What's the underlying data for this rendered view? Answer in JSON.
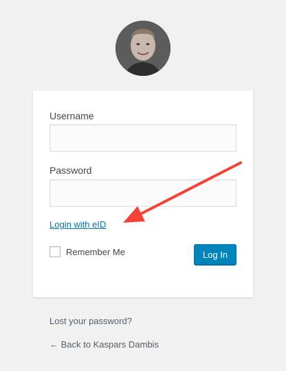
{
  "form": {
    "username_label": "Username",
    "username_value": "",
    "password_label": "Password",
    "password_value": "",
    "eid_link": "Login with eID",
    "remember_label": "Remember Me",
    "remember_checked": false,
    "login_button": "Log In"
  },
  "footer": {
    "lost_password": "Lost your password?",
    "back_link": "← Back to Kaspars Dambis"
  },
  "colors": {
    "page_background": "#f1f1f1",
    "primary_button": "#0085ba",
    "link": "#0073aa",
    "annotation_arrow": "#f44336"
  },
  "icons": {
    "avatar": "user-avatar-photo",
    "annotation": "red-arrow-annotation"
  }
}
